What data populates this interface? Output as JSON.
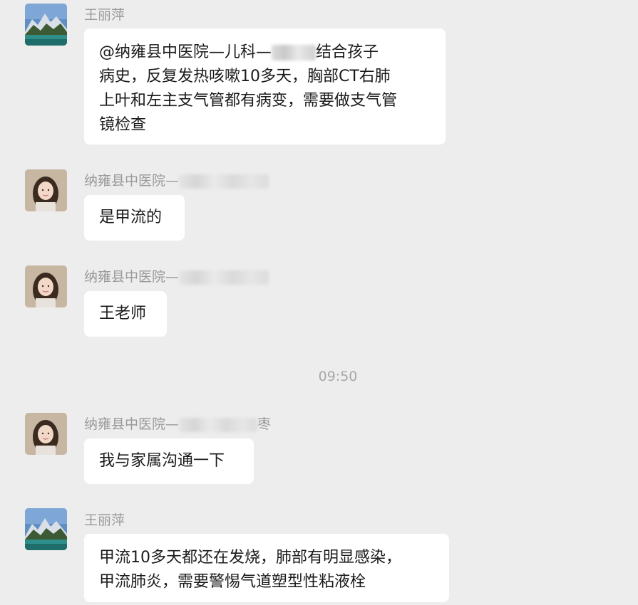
{
  "messages": [
    {
      "sender": "王丽萍",
      "text_before": "@纳雍县中医院—儿科—",
      "text_after": "结合孩子",
      "line2": "病史，反复发热咳嗽10多天，胸部CT右肺",
      "line3": "上叶和左主支气管都有病变，需要做支气管",
      "line4": "镜检查"
    },
    {
      "sender": "纳雍县中医院—",
      "text": "是甲流的"
    },
    {
      "sender": "纳雍县中医院—",
      "text": "王老师"
    },
    {
      "timestamp": "09:50"
    },
    {
      "sender": "纳雍县中医院—",
      "sender_suffix": "枣",
      "text": "我与家属沟通一下"
    },
    {
      "sender": "王丽萍",
      "line1": "甲流10多天都还在发烧，肺部有明显感染，",
      "line2": "甲流肺炎，需要警惕气道塑型性粘液栓"
    }
  ],
  "avatars": {
    "landscape": "mountain-lake-avatar",
    "person": "young-woman-avatar"
  },
  "colors": {
    "background": "#ededed",
    "bubble": "#ffffff",
    "sender_text": "#9a9a9a",
    "message_text": "#1a1a1a",
    "timestamp_text": "#a8a8a8"
  }
}
